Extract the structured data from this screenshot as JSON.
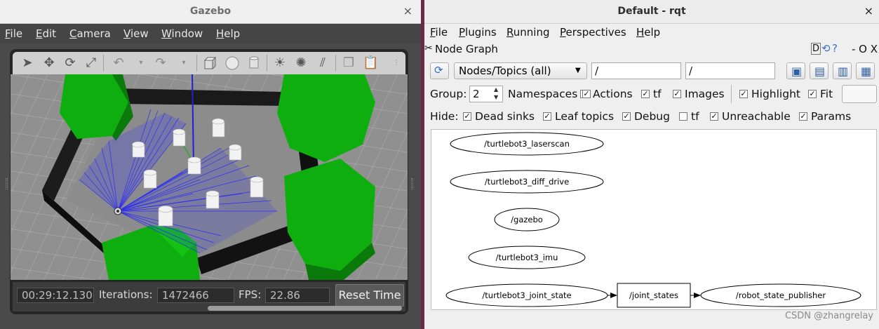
{
  "gazebo": {
    "title": "Gazebo",
    "close": "×",
    "menu": [
      "File",
      "Edit",
      "Camera",
      "View",
      "Window",
      "Help"
    ],
    "status": {
      "sim_time": "00:29:12.130",
      "iterations_label": "Iterations:",
      "iterations": "1472466",
      "fps_label": "FPS:",
      "fps": "22.86",
      "reset_label": "Reset Time"
    }
  },
  "rqt": {
    "title": "Default - rqt",
    "close": "×",
    "menu": [
      "File",
      "Plugins",
      "Running",
      "Perspectives",
      "Help"
    ],
    "plugin_title": "Node Graph",
    "plugin_controls": "D",
    "plugin_right": "- O X",
    "filter_select": "Nodes/Topics (all)",
    "filter_ns": "/",
    "filter_exclude": "/",
    "group_label": "Group:",
    "group_value": "2",
    "namespaces_label": "Namespaces",
    "options": [
      {
        "label": "Actions",
        "checked": true
      },
      {
        "label": "tf",
        "checked": true
      },
      {
        "label": "Images",
        "checked": true
      },
      {
        "label": "Highlight",
        "checked": true
      },
      {
        "label": "Fit",
        "checked": true
      }
    ],
    "namespaces_checked": true,
    "hide_label": "Hide:",
    "hide_options": [
      {
        "label": "Dead sinks",
        "checked": true
      },
      {
        "label": "Leaf topics",
        "checked": true
      },
      {
        "label": "Debug",
        "checked": true
      },
      {
        "label": "tf",
        "checked": false
      },
      {
        "label": "Unreachable",
        "checked": true
      },
      {
        "label": "Params",
        "checked": true
      }
    ],
    "graph": {
      "nodes": [
        "/turtlebot3_laserscan",
        "/turtlebot3_diff_drive",
        "/gazebo",
        "/turtlebot3_imu",
        "/turtlebot3_joint_state",
        "/robot_state_publisher"
      ],
      "topic": "/joint_states"
    },
    "watermark": "CSDN @zhangrelay"
  }
}
